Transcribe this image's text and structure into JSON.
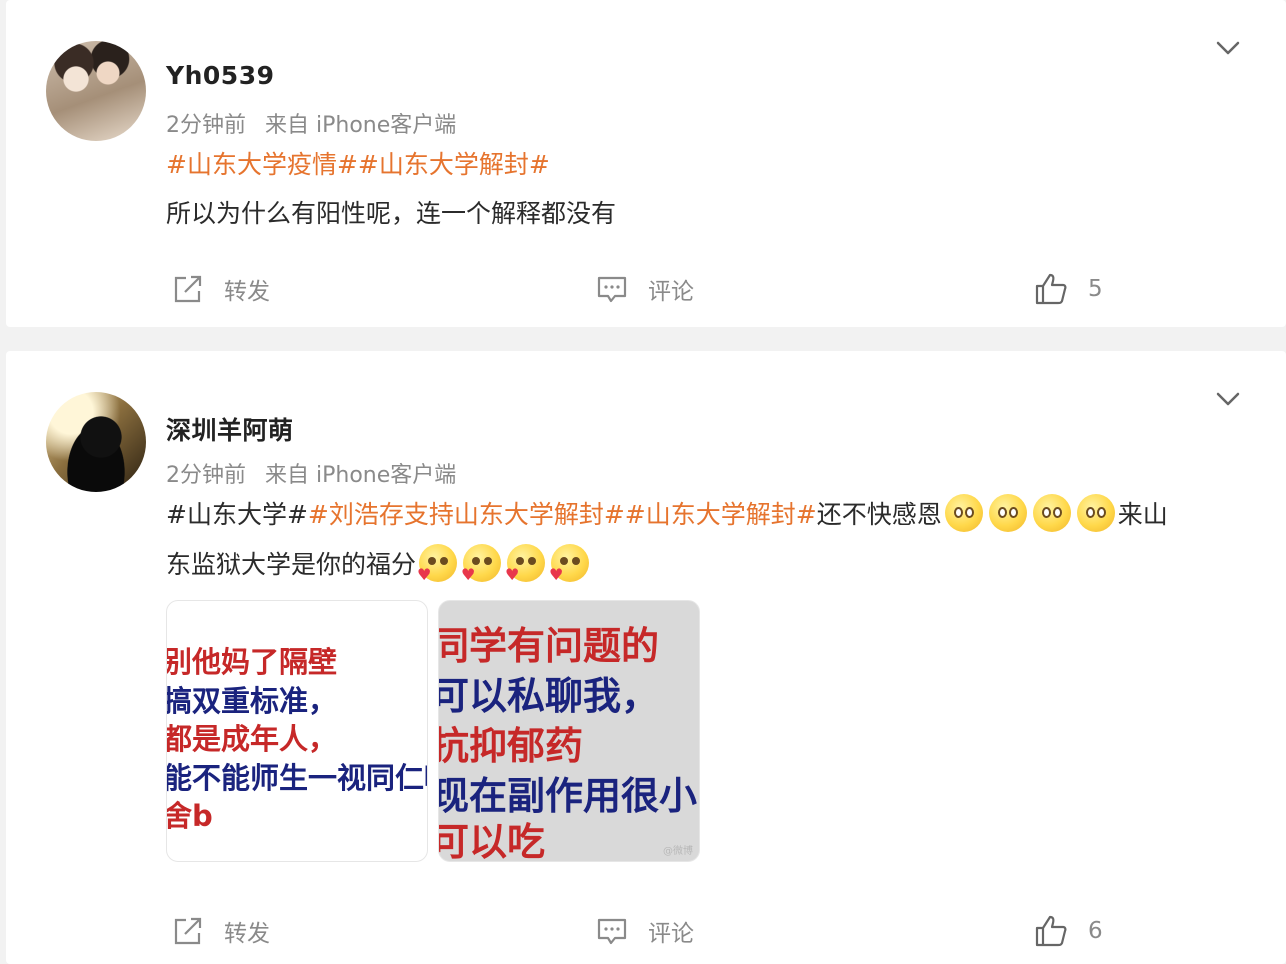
{
  "posts": [
    {
      "username": "Yh0539",
      "time": "2分钟前",
      "source": "来自 iPhone客户端",
      "tags": "#山东大学疫情##山东大学解封#",
      "text": "所以为什么有阳性呢，连一个解释都没有",
      "actions": {
        "repost": "转发",
        "comment": "评论",
        "likes": "5"
      }
    },
    {
      "username": "深圳羊阿萌",
      "time": "2分钟前",
      "source": "来自 iPhone客户端",
      "line1": {
        "plain1": "#山东大学#",
        "tags": "#刘浩存支持山东大学解封##山东大学解封#",
        "plain2": "还不快感恩",
        "plain3": "来山"
      },
      "line2": {
        "plain1": "东监狱大学是你的福分"
      },
      "images": [
        {
          "lines": [
            "别他妈了隔壁",
            "搞双重标准，",
            "都是成年人，",
            "能不能师生一视同仁呢",
            "舍b"
          ],
          "colors": [
            "#c62828",
            "#1a237e",
            "#c62828",
            "#1a237e",
            "#c62828"
          ]
        },
        {
          "lines": [
            "同学有问题的",
            "可以私聊我，",
            "抗抑郁药",
            "现在副作用很小",
            "可以吃"
          ],
          "colors": [
            "#c62828",
            "#1a237e",
            "#c62828",
            "#1a237e",
            "#c62828"
          ],
          "watermark": "@微博"
        }
      ],
      "actions": {
        "repost": "转发",
        "comment": "评论",
        "likes": "6"
      }
    }
  ],
  "colors": {
    "tag": "#e6742e",
    "meta": "#8a8a8a",
    "card": "#ffffff",
    "background": "#f2f2f2"
  },
  "icons": [
    "chevron-down-icon",
    "repost-icon",
    "comment-icon",
    "like-icon",
    "emoji-pleading-icon",
    "emoji-love-icon"
  ]
}
